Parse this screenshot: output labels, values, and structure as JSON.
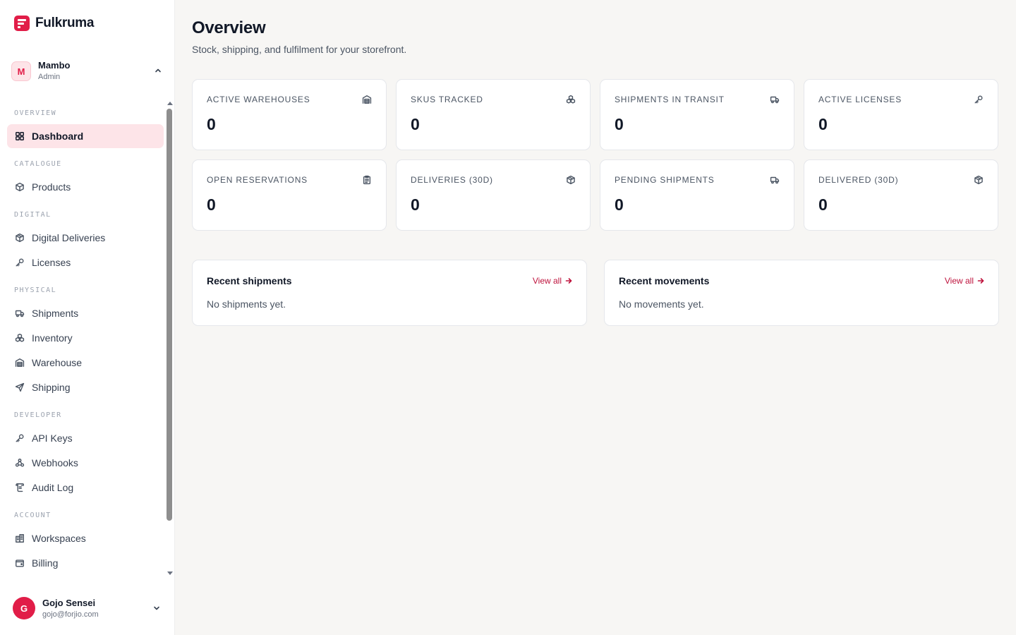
{
  "brand": {
    "name": "Fulkruma",
    "accent": "#e11d48"
  },
  "workspace": {
    "initial": "M",
    "name": "Mambo",
    "role": "Admin"
  },
  "sidebar": {
    "sections": [
      {
        "label": "OVERVIEW",
        "items": [
          {
            "label": "Dashboard",
            "icon": "grid-icon",
            "active": true
          }
        ]
      },
      {
        "label": "CATALOGUE",
        "items": [
          {
            "label": "Products",
            "icon": "box-icon"
          }
        ]
      },
      {
        "label": "DIGITAL",
        "items": [
          {
            "label": "Digital Deliveries",
            "icon": "package-icon"
          },
          {
            "label": "Licenses",
            "icon": "key-icon"
          }
        ]
      },
      {
        "label": "PHYSICAL",
        "items": [
          {
            "label": "Shipments",
            "icon": "truck-icon"
          },
          {
            "label": "Inventory",
            "icon": "boxes-icon"
          },
          {
            "label": "Warehouse",
            "icon": "warehouse-icon"
          },
          {
            "label": "Shipping",
            "icon": "send-icon"
          }
        ]
      },
      {
        "label": "DEVELOPER",
        "items": [
          {
            "label": "API Keys",
            "icon": "key-icon"
          },
          {
            "label": "Webhooks",
            "icon": "webhook-icon"
          },
          {
            "label": "Audit Log",
            "icon": "scroll-icon"
          }
        ]
      },
      {
        "label": "ACCOUNT",
        "items": [
          {
            "label": "Workspaces",
            "icon": "building-icon"
          },
          {
            "label": "Billing",
            "icon": "wallet-icon"
          }
        ]
      }
    ]
  },
  "user": {
    "initial": "G",
    "name": "Gojo Sensei",
    "email": "gojo@forjio.com"
  },
  "page": {
    "title": "Overview",
    "subtitle": "Stock, shipping, and fulfilment for your storefront."
  },
  "stats": [
    {
      "label": "ACTIVE WAREHOUSES",
      "value": "0",
      "icon": "warehouse-icon"
    },
    {
      "label": "SKUS TRACKED",
      "value": "0",
      "icon": "boxes-icon"
    },
    {
      "label": "SHIPMENTS IN TRANSIT",
      "value": "0",
      "icon": "truck-icon"
    },
    {
      "label": "ACTIVE LICENSES",
      "value": "0",
      "icon": "key-icon"
    },
    {
      "label": "OPEN RESERVATIONS",
      "value": "0",
      "icon": "clipboard-icon"
    },
    {
      "label": "DELIVERIES (30D)",
      "value": "0",
      "icon": "package-icon"
    },
    {
      "label": "PENDING SHIPMENTS",
      "value": "0",
      "icon": "truck-icon"
    },
    {
      "label": "DELIVERED (30D)",
      "value": "0",
      "icon": "package-icon"
    }
  ],
  "panels": [
    {
      "title": "Recent shipments",
      "link": "View all",
      "empty": "No shipments yet."
    },
    {
      "title": "Recent movements",
      "link": "View all",
      "empty": "No movements yet."
    }
  ]
}
